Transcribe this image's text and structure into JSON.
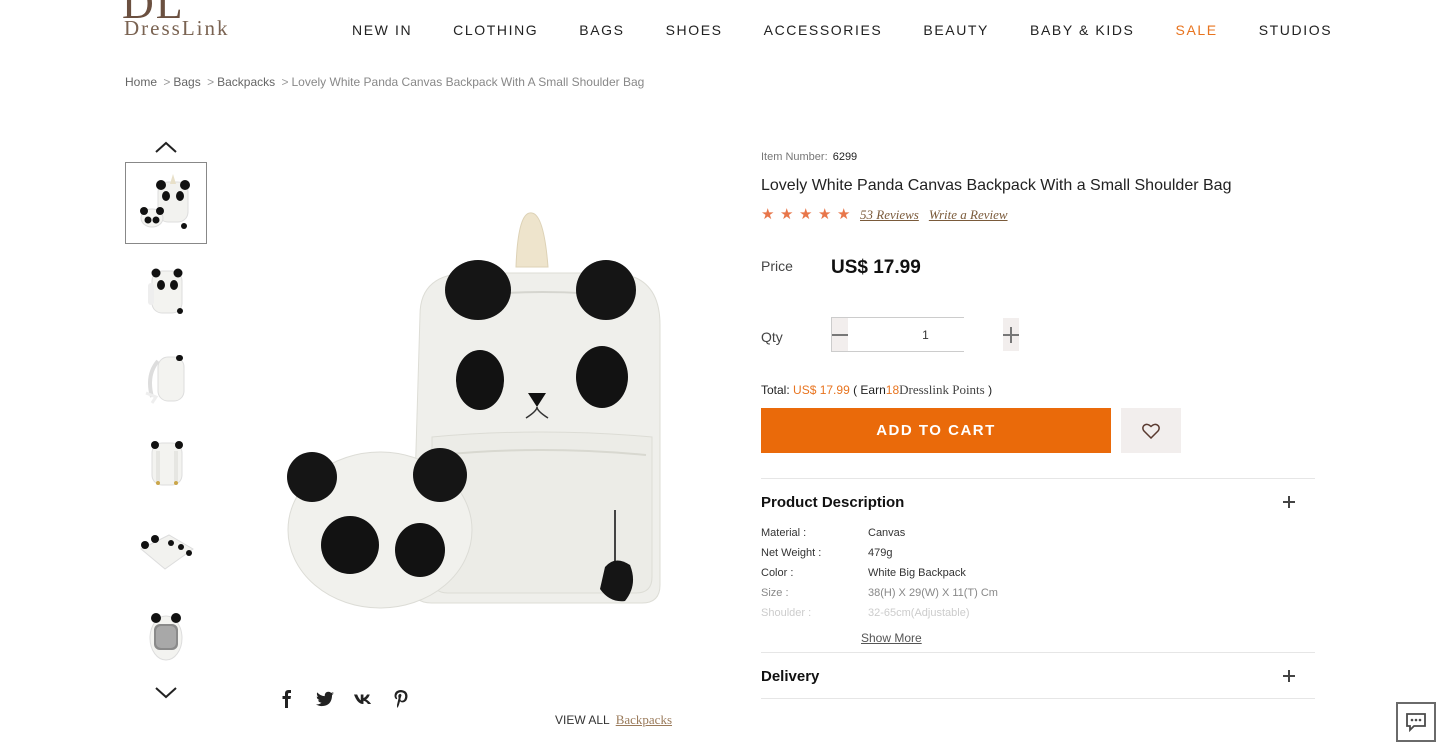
{
  "header": {
    "logo_mark": "DL",
    "logo_text": "DressLink",
    "nav": [
      "NEW IN",
      "CLOTHING",
      "BAGS",
      "SHOES",
      "ACCESSORIES",
      "BEAUTY",
      "BABY & KIDS",
      "SALE",
      "STUDIOS"
    ]
  },
  "breadcrumb": {
    "items": [
      "Home",
      "Bags",
      "Backpacks"
    ],
    "current": "Lovely White Panda Canvas Backpack With A Small Shoulder Bag"
  },
  "gallery": {
    "thumb_count": 6,
    "active_index": 0
  },
  "social": [
    "facebook-icon",
    "twitter-icon",
    "vk-icon",
    "pinterest-icon"
  ],
  "view_all": {
    "label": "VIEW ALL",
    "link": "Backpacks"
  },
  "product": {
    "item_number_label": "Item Number:",
    "item_number": "6299",
    "title": "Lovely White Panda Canvas Backpack With a Small Shoulder Bag",
    "rating_stars": 5,
    "reviews": "53 Reviews",
    "write_review": "Write a Review",
    "price_label": "Price",
    "price": "US$ 17.99",
    "qty_label": "Qty",
    "qty": "1",
    "total_label": "Total:",
    "total_amount": "US$ 17.99",
    "earn_prefix": "( Earn",
    "points": "18",
    "points_brand": "Dresslink Points",
    "earn_suffix": ")",
    "add_to_cart": "ADD TO CART",
    "accent_color": "#ea6a0a",
    "star_color": "#e8764a"
  },
  "description": {
    "title": "Product Description",
    "specs": [
      {
        "label": "Material :",
        "value": "Canvas"
      },
      {
        "label": "Net Weight :",
        "value": "479g"
      },
      {
        "label": "Color :",
        "value": "White Big Backpack"
      },
      {
        "label": "Size :",
        "value": "38(H) X 29(W) X 11(T) Cm"
      },
      {
        "label": "Shoulder :",
        "value": "32-65cm(Adjustable)"
      }
    ],
    "show_more": "Show More"
  },
  "delivery": {
    "title": "Delivery"
  }
}
